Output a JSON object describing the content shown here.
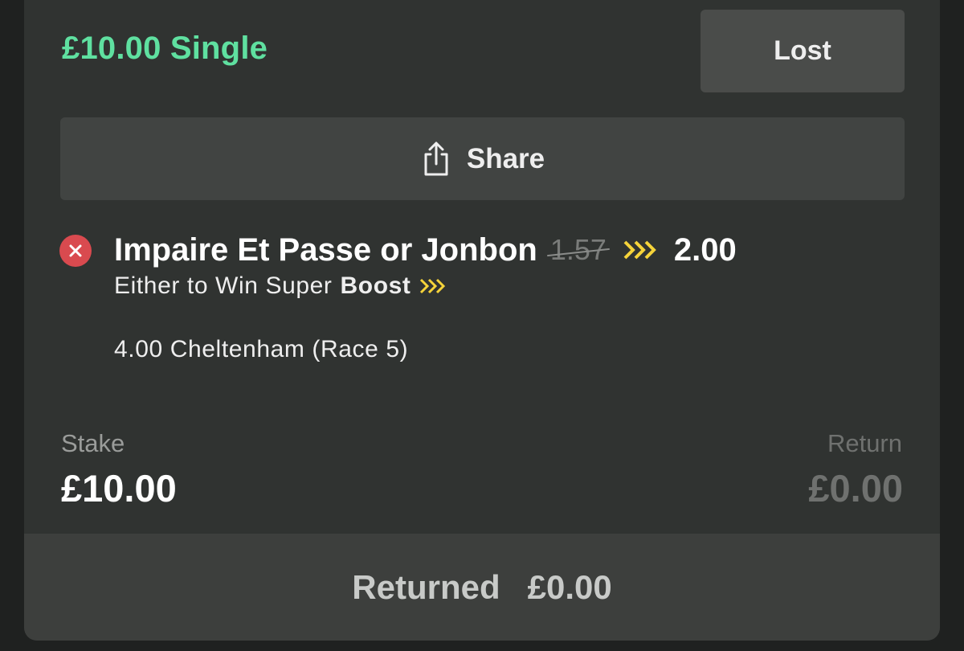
{
  "bet": {
    "title": "£10.00 Single",
    "status": "Lost"
  },
  "share": {
    "label": "Share",
    "icon": "share-icon"
  },
  "selection": {
    "result_icon": "close-icon",
    "name": "Impaire Et Passe or Jonbon",
    "old_odds": "1.57",
    "new_odds": "2.00",
    "market_prefix": "Either to Win Super",
    "market_boost": "Boost",
    "event": "4.00 Cheltenham (Race 5)"
  },
  "summary": {
    "stake_label": "Stake",
    "stake_value": "£10.00",
    "return_label": "Return",
    "return_value": "£0.00"
  },
  "footer": {
    "returned_label": "Returned",
    "returned_value": "£0.00"
  },
  "colors": {
    "title_green": "#5fe0a0",
    "lost_red": "#d94a4f",
    "boost_yellow": "#f5d33a",
    "card_bg": "#303331"
  }
}
